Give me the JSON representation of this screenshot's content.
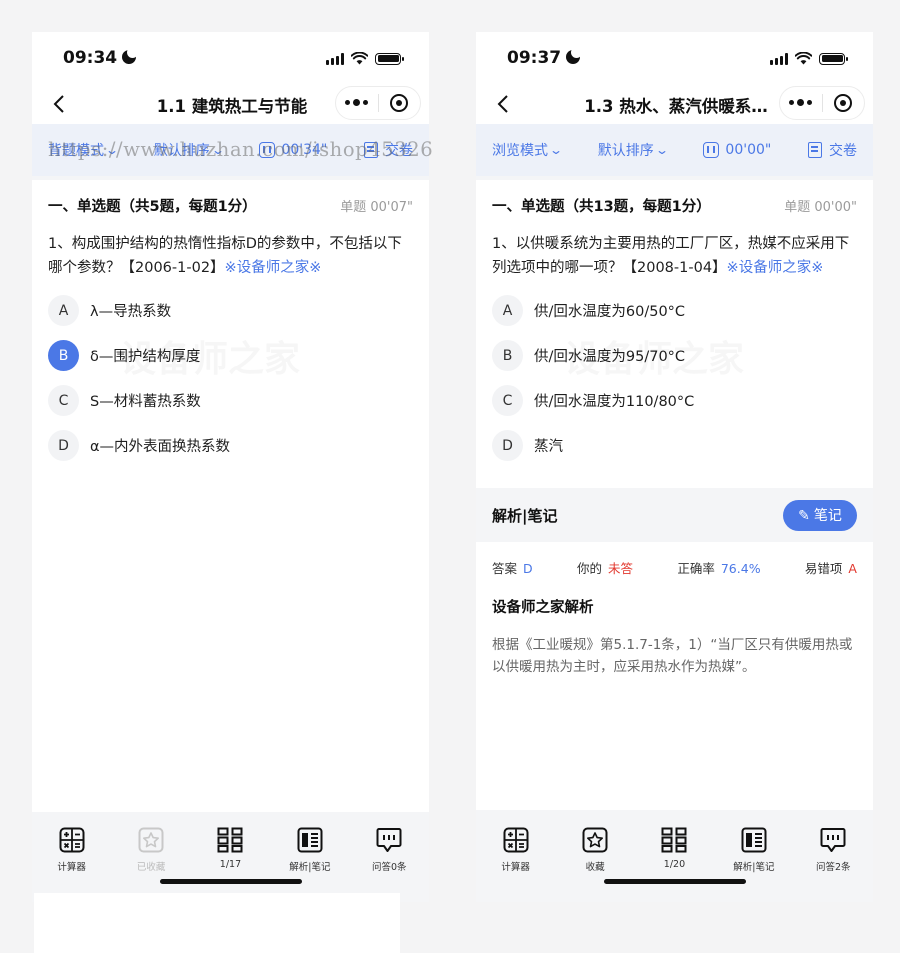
{
  "watermark_url": "https://www.huzhan.com/ishop45326",
  "screens": [
    {
      "status": {
        "time": "09:34"
      },
      "nav_title": "1.1 建筑热工与节能",
      "toolbar": {
        "mode": "背题模式",
        "sort": "默认排序",
        "timer": "00'34\"",
        "submit": "交卷"
      },
      "section_title": "一、单选题（共5题，每题1分）",
      "per_question_time": "单题 00'07\"",
      "question": {
        "text": "1、构成围护结构的热惰性指标D的参数中，不包括以下哪个参数？【2006-1-02】",
        "tag": "※设备师之家※"
      },
      "watermark": "设备师之家",
      "options": [
        {
          "letter": "A",
          "text": "λ—导热系数",
          "selected": false
        },
        {
          "letter": "B",
          "text": "δ—围护结构厚度",
          "selected": true
        },
        {
          "letter": "C",
          "text": "S—材料蓄热系数",
          "selected": false
        },
        {
          "letter": "D",
          "text": "α—内外表面换热系数",
          "selected": false
        }
      ],
      "bottom": {
        "calc": "计算器",
        "fav": "已收藏",
        "progress": "1/17",
        "analysis": "解析|笔记",
        "qa": "问答0条"
      }
    },
    {
      "status": {
        "time": "09:37"
      },
      "nav_title": "1.3 热水、蒸汽供暖系…",
      "toolbar": {
        "mode": "浏览模式",
        "sort": "默认排序",
        "timer": "00'00\"",
        "submit": "交卷"
      },
      "section_title": "一、单选题（共13题，每题1分）",
      "per_question_time": "单题 00'00\"",
      "question": {
        "text": "1、以供暖系统为主要用热的工厂厂区，热媒不应采用下列选项中的哪一项？【2008-1-04】",
        "tag": "※设备师之家※"
      },
      "watermark": "设备师之家",
      "options": [
        {
          "letter": "A",
          "text": "供/回水温度为60/50°C",
          "selected": false
        },
        {
          "letter": "B",
          "text": "供/回水温度为95/70°C",
          "selected": false
        },
        {
          "letter": "C",
          "text": "供/回水温度为110/80°C",
          "selected": false
        },
        {
          "letter": "D",
          "text": "蒸汽",
          "selected": false
        }
      ],
      "analysis": {
        "label": "解析|笔记",
        "note_button": "笔记",
        "answer_label": "答案",
        "answer_value": "D",
        "yours_label": "你的",
        "yours_value": "未答",
        "accuracy_label": "正确率",
        "accuracy_value": "76.4%",
        "common_wrong_label": "易错项",
        "common_wrong_value": "A",
        "explanation_title": "设备师之家解析",
        "explanation_body": "根据《工业暖规》第5.1.7-1条，1）“当厂区只有供暖用热或以供暖用热为主时，应采用热水作为热媒”。"
      },
      "bottom": {
        "calc": "计算器",
        "fav": "收藏",
        "progress": "1/20",
        "analysis": "解析|笔记",
        "qa": "问答2条"
      }
    }
  ]
}
